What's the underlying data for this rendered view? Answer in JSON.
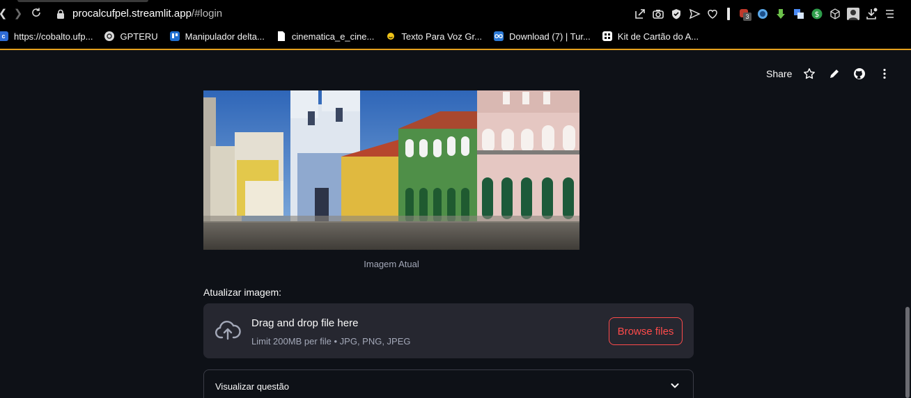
{
  "browser": {
    "url_host": "procalcufpel.streamlit.app",
    "url_path": "/#login",
    "bookmarks": [
      {
        "label": "https://cobalto.ufp...",
        "icon": "cobalto-icon",
        "color": "#2e6bd6"
      },
      {
        "label": "GPTERU",
        "icon": "openai-icon",
        "color": "#d9d9d9"
      },
      {
        "label": "Manipulador delta...",
        "icon": "trello-icon",
        "color": "#1f6fd1"
      },
      {
        "label": "cinematica_e_cine...",
        "icon": "document-icon",
        "color": "#ffffff"
      },
      {
        "label": "Texto Para Voz Gr...",
        "icon": "smiley-icon",
        "color": "#f0c419"
      },
      {
        "label": "Download (7) | Tur...",
        "icon": "infinity-icon",
        "color": "#2b79d6"
      },
      {
        "label": "Kit de Cartão do A...",
        "icon": "grid-icon",
        "color": "#ffffff"
      }
    ],
    "extension_badge": "3"
  },
  "header": {
    "share_label": "Share"
  },
  "main": {
    "image_caption": "Imagem Atual",
    "upload": {
      "label": "Atualizar imagem:",
      "title": "Drag and drop file here",
      "subtitle": "Limit 200MB per file • JPG, PNG, JPEG",
      "button_label": "Browse files"
    },
    "expander": {
      "title": "Visualizar questão"
    }
  },
  "colors": {
    "background": "#0e1117",
    "accent": "#ff4b4b",
    "dropzone": "#262730",
    "muted_text": "#a3a8b8"
  }
}
